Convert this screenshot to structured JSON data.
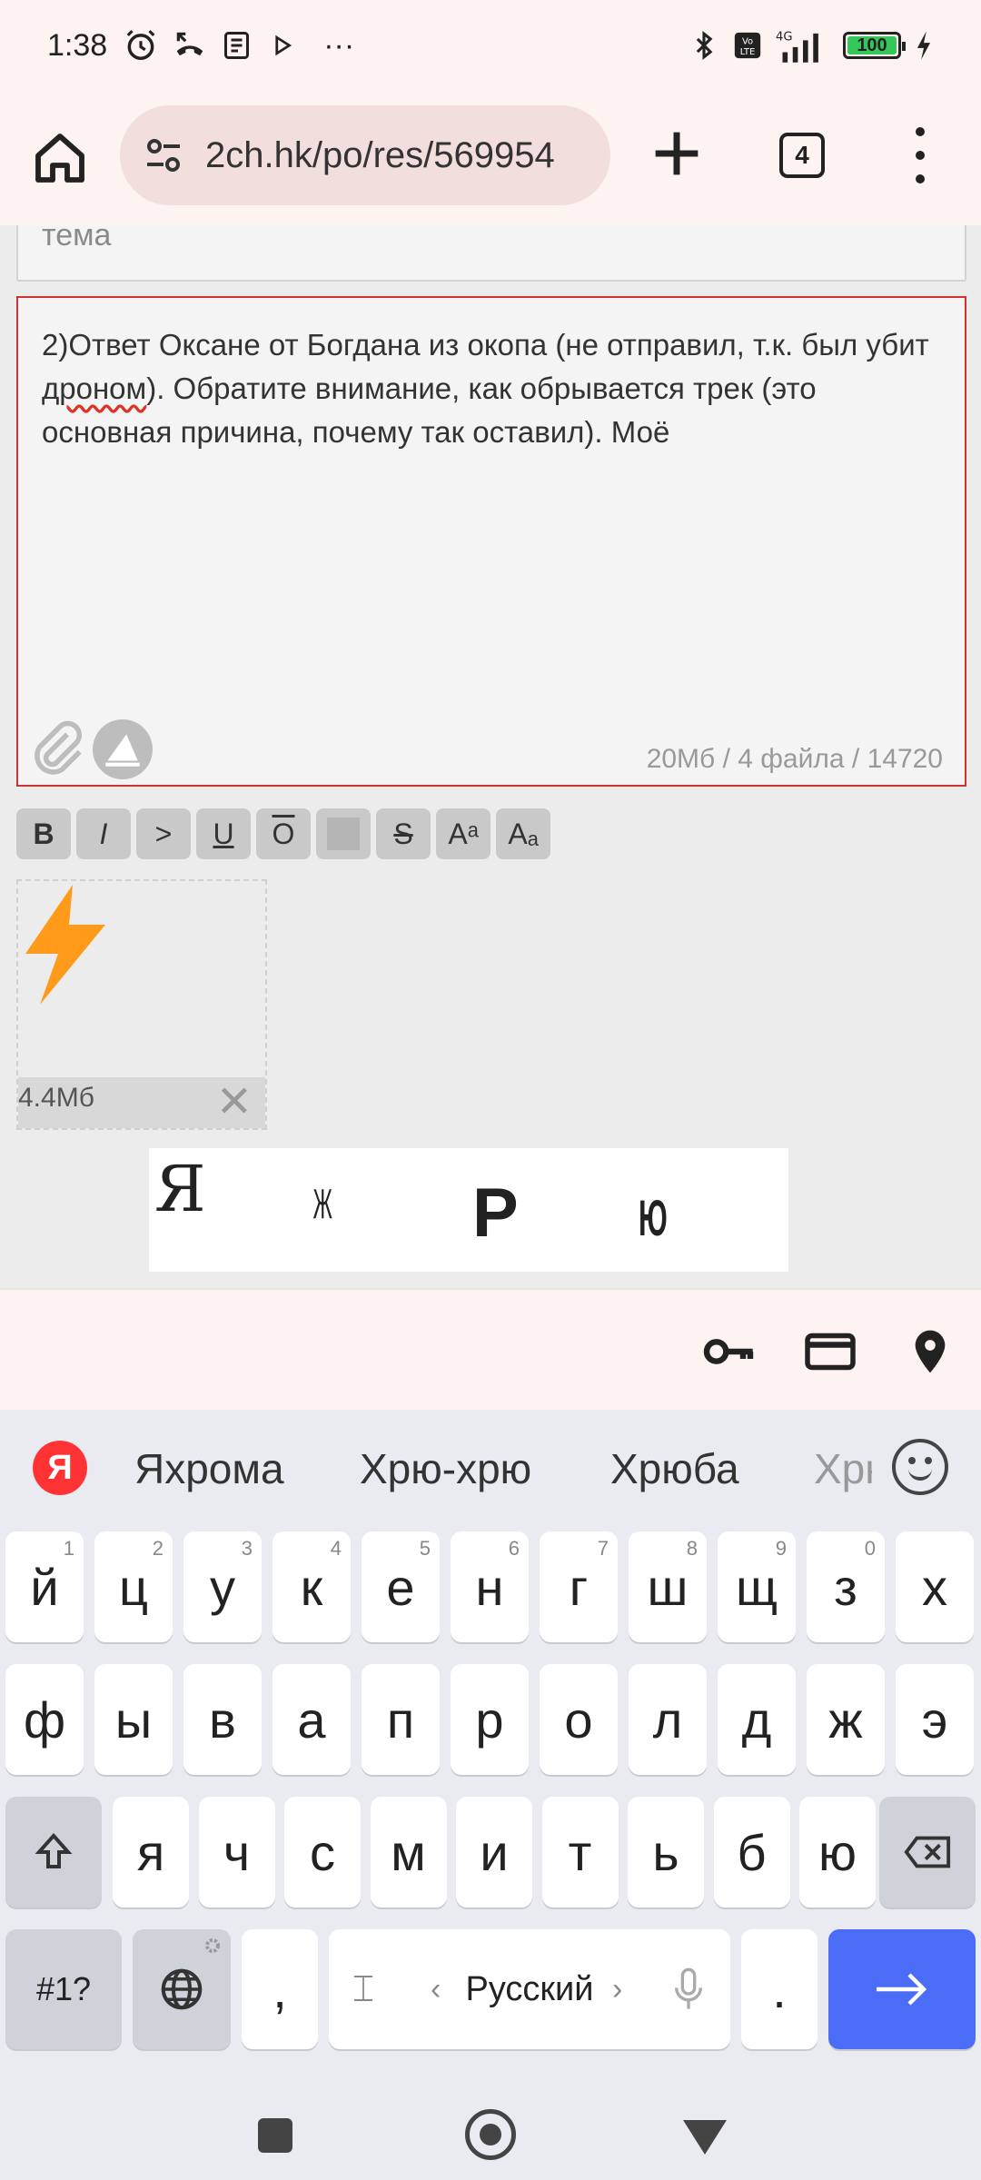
{
  "status_bar": {
    "time": "1:38",
    "more": "···",
    "battery": "100"
  },
  "browser": {
    "url": "2ch.hk/po/res/569954",
    "tab_count": "4"
  },
  "post_form": {
    "subject_placeholder": "тема",
    "comment_before": "2)Ответ Оксане от Богдана из окопа (не отправил, т.к. был убит ",
    "comment_misspelled": "дроном",
    "comment_after": "). Обратите внимание, как обрывается трек (это основная причина, почему так оставил). Моё",
    "limits": "20Мб / 4 файла / 14720",
    "format_buttons": [
      "B",
      "I",
      ">",
      "U",
      "O",
      "",
      "S",
      "Aᵃ",
      "Aₐ"
    ],
    "attachment_size": "4.4Мб",
    "captcha_glyphs": [
      "Я",
      "Ж",
      "Р",
      "Ю"
    ]
  },
  "keyboard": {
    "logo": "Я",
    "suggestions": [
      "Яхрома",
      "Хрю-хрю",
      "Хрюба",
      "Хрю"
    ],
    "row1": [
      [
        "й",
        "1"
      ],
      [
        "ц",
        "2"
      ],
      [
        "у",
        "3"
      ],
      [
        "к",
        "4"
      ],
      [
        "е",
        "5"
      ],
      [
        "н",
        "6"
      ],
      [
        "г",
        "7"
      ],
      [
        "ш",
        "8"
      ],
      [
        "щ",
        "9"
      ],
      [
        "з",
        "0"
      ],
      [
        "х",
        ""
      ]
    ],
    "row2": [
      "ф",
      "ы",
      "в",
      "а",
      "п",
      "р",
      "о",
      "л",
      "д",
      "ж",
      "э"
    ],
    "row3": [
      "я",
      "ч",
      "с",
      "м",
      "и",
      "т",
      "ь",
      "б",
      "ю"
    ],
    "symbols_key": "#1?",
    "comma": ",",
    "language": "Русский",
    "period": "."
  },
  "colors": {
    "accent": "#4a6cf7",
    "error_border": "#cc3333",
    "yandex": "#ff3333",
    "bolt": "#ff9a1a"
  }
}
